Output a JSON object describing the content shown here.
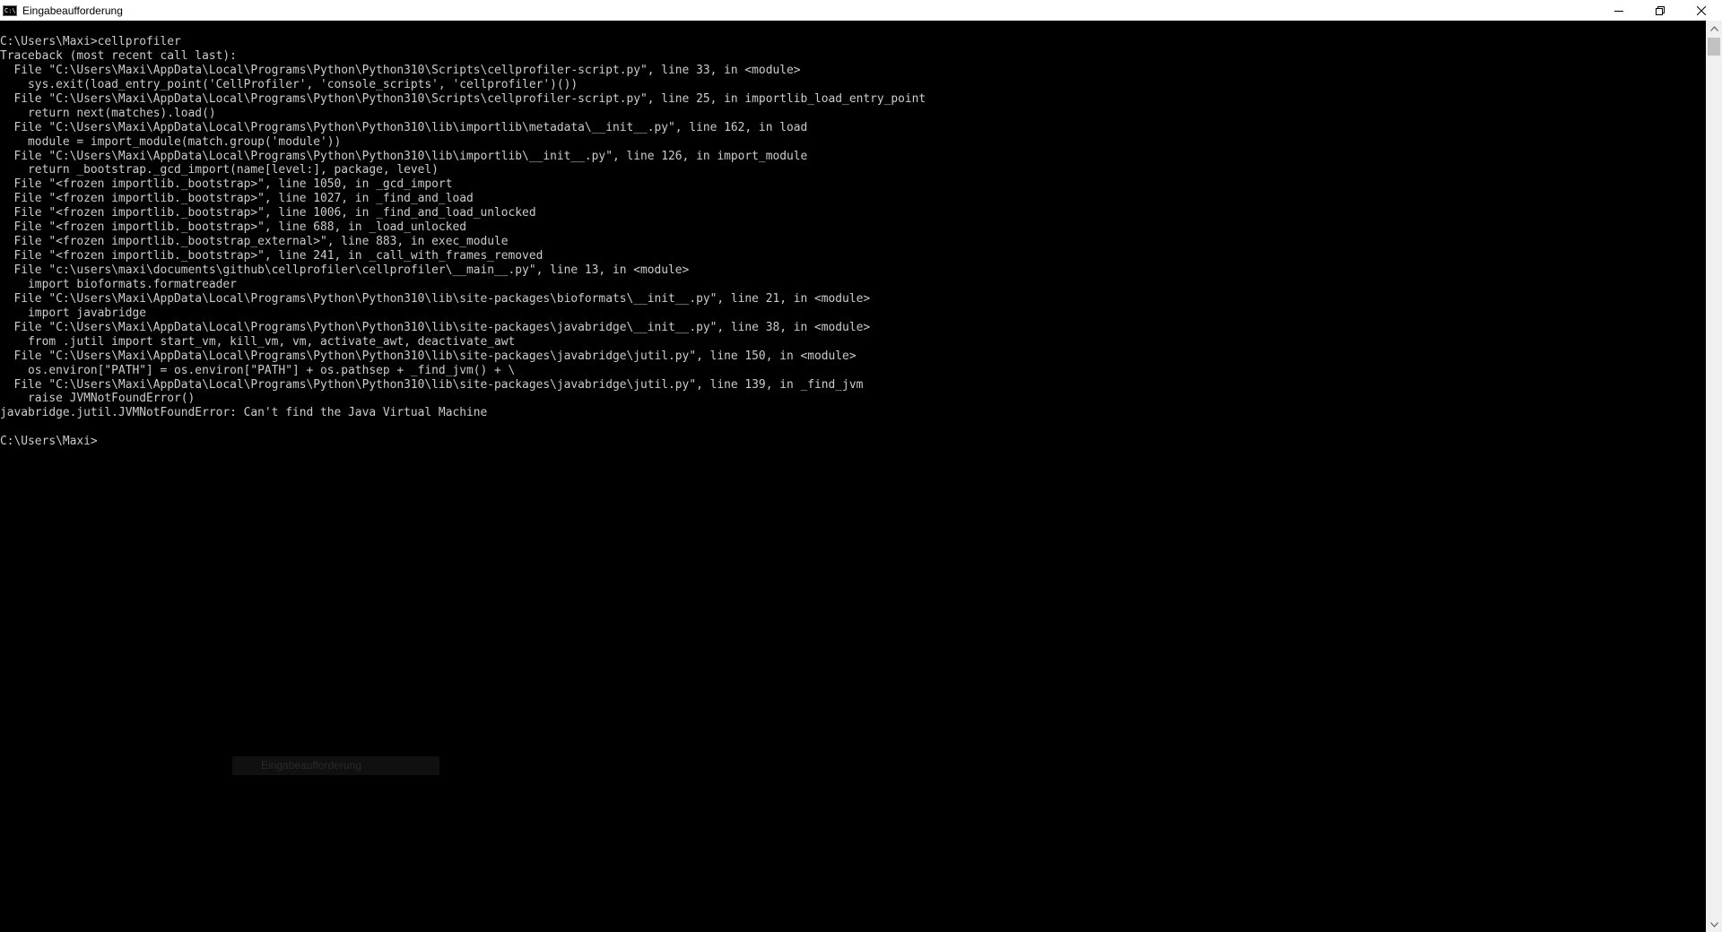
{
  "window": {
    "title": "Eingabeaufforderung",
    "icon": "console-icon",
    "controls": [
      "minimize-icon",
      "restore-icon",
      "close-icon"
    ]
  },
  "console": {
    "lines": [
      "C:\\Users\\Maxi>cellprofiler",
      "Traceback (most recent call last):",
      "  File \"C:\\Users\\Maxi\\AppData\\Local\\Programs\\Python\\Python310\\Scripts\\cellprofiler-script.py\", line 33, in <module>",
      "    sys.exit(load_entry_point('CellProfiler', 'console_scripts', 'cellprofiler')())",
      "  File \"C:\\Users\\Maxi\\AppData\\Local\\Programs\\Python\\Python310\\Scripts\\cellprofiler-script.py\", line 25, in importlib_load_entry_point",
      "    return next(matches).load()",
      "  File \"C:\\Users\\Maxi\\AppData\\Local\\Programs\\Python\\Python310\\lib\\importlib\\metadata\\__init__.py\", line 162, in load",
      "    module = import_module(match.group('module'))",
      "  File \"C:\\Users\\Maxi\\AppData\\Local\\Programs\\Python\\Python310\\lib\\importlib\\__init__.py\", line 126, in import_module",
      "    return _bootstrap._gcd_import(name[level:], package, level)",
      "  File \"<frozen importlib._bootstrap>\", line 1050, in _gcd_import",
      "  File \"<frozen importlib._bootstrap>\", line 1027, in _find_and_load",
      "  File \"<frozen importlib._bootstrap>\", line 1006, in _find_and_load_unlocked",
      "  File \"<frozen importlib._bootstrap>\", line 688, in _load_unlocked",
      "  File \"<frozen importlib._bootstrap_external>\", line 883, in exec_module",
      "  File \"<frozen importlib._bootstrap>\", line 241, in _call_with_frames_removed",
      "  File \"c:\\users\\maxi\\documents\\github\\cellprofiler\\cellprofiler\\__main__.py\", line 13, in <module>",
      "    import bioformats.formatreader",
      "  File \"C:\\Users\\Maxi\\AppData\\Local\\Programs\\Python\\Python310\\lib\\site-packages\\bioformats\\__init__.py\", line 21, in <module>",
      "    import javabridge",
      "  File \"C:\\Users\\Maxi\\AppData\\Local\\Programs\\Python\\Python310\\lib\\site-packages\\javabridge\\__init__.py\", line 38, in <module>",
      "    from .jutil import start_vm, kill_vm, vm, activate_awt, deactivate_awt",
      "  File \"C:\\Users\\Maxi\\AppData\\Local\\Programs\\Python\\Python310\\lib\\site-packages\\javabridge\\jutil.py\", line 150, in <module>",
      "    os.environ[\"PATH\"] = os.environ[\"PATH\"] + os.pathsep + _find_jvm() + \\",
      "  File \"C:\\Users\\Maxi\\AppData\\Local\\Programs\\Python\\Python310\\lib\\site-packages\\javabridge\\jutil.py\", line 139, in _find_jvm",
      "    raise JVMNotFoundError()",
      "javabridge.jutil.JVMNotFoundError: Can't find the Java Virtual Machine",
      "",
      "C:\\Users\\Maxi>"
    ]
  },
  "overlay": {
    "text": "Eingabeaufforderung"
  },
  "scrollbar": {
    "up_icon": "chevron-up-icon",
    "down_icon": "chevron-down-icon"
  }
}
